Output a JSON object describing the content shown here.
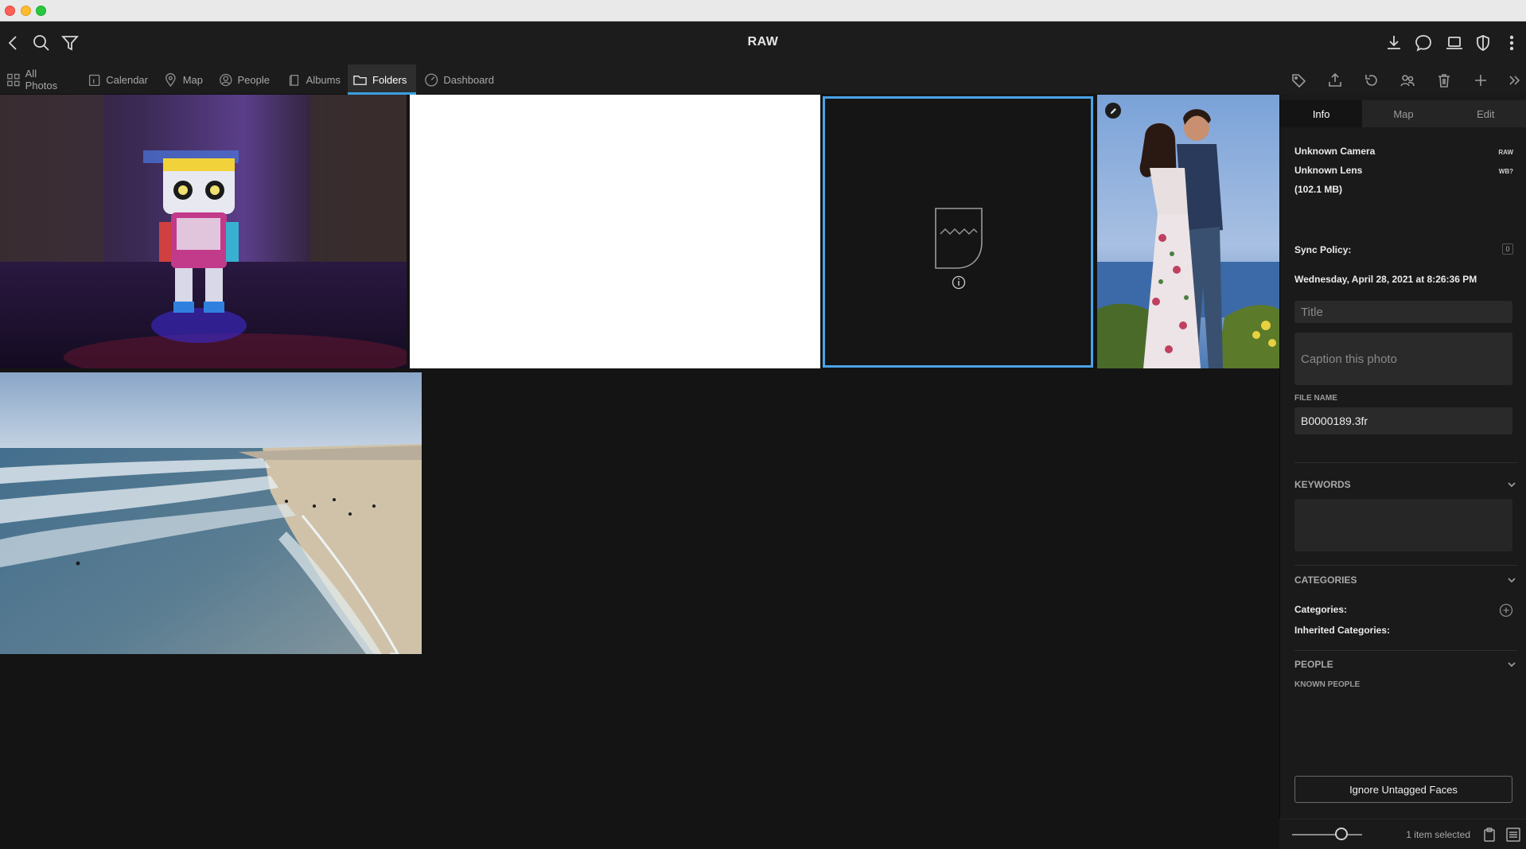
{
  "window": {
    "title": "RAW"
  },
  "nav": {
    "tabs": [
      {
        "label": "All Photos",
        "icon": "grid-icon"
      },
      {
        "label": "Calendar",
        "icon": "calendar-icon"
      },
      {
        "label": "Map",
        "icon": "map-pin-icon"
      },
      {
        "label": "People",
        "icon": "person-icon"
      },
      {
        "label": "Albums",
        "icon": "album-icon"
      },
      {
        "label": "Folders",
        "icon": "folder-icon",
        "active": true
      },
      {
        "label": "Dashboard",
        "icon": "gauge-icon"
      }
    ]
  },
  "panel": {
    "tabs": [
      "Info",
      "Map",
      "Edit"
    ],
    "active_tab": "Info",
    "camera": "Unknown Camera",
    "lens": "Unknown Lens",
    "size": "(102.1 MB)",
    "raw_badge": "RAW",
    "wb_badge": "WB?",
    "sync_label": "Sync Policy:",
    "sync_value": "0",
    "date": "Wednesday, April 28, 2021 at 8:26:36 PM",
    "title_placeholder": "Title",
    "caption_placeholder": "Caption this photo",
    "file_name_label": "FILE NAME",
    "file_name": "B0000189.3fr",
    "keywords_label": "KEYWORDS",
    "categories_label": "CATEGORIES",
    "categories_field": "Categories:",
    "inherited_categories": "Inherited Categories:",
    "people_label": "PEOPLE",
    "known_people": "KNOWN PEOPLE",
    "ignore_button": "Ignore Untagged Faces"
  },
  "status": {
    "selection": "1 item selected",
    "zoom_level": 0.7
  },
  "colors": {
    "accent": "#3aa0e0",
    "selection_border": "#4aa3e8"
  }
}
